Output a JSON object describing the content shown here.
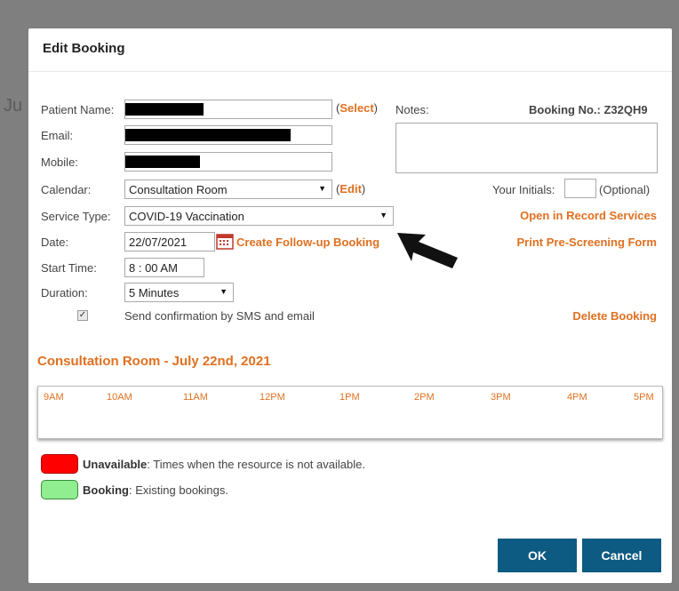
{
  "background": {
    "fragment": "Ju"
  },
  "dialog": {
    "title": "Edit Booking",
    "patient_name": {
      "label": "Patient Name:",
      "select_link": "Select",
      "open_paren": "(",
      "close_paren": ")"
    },
    "email": {
      "label": "Email:"
    },
    "mobile": {
      "label": "Mobile:"
    },
    "notes": {
      "label": "Notes:"
    },
    "booking_no": "Booking No.: Z32QH9",
    "calendar": {
      "label": "Calendar:",
      "value": "Consultation Room",
      "edit_link": "Edit",
      "open_paren": "(",
      "close_paren": ")"
    },
    "initials": {
      "label": "Your Initials:",
      "value": "",
      "optional": "(Optional)"
    },
    "service_type": {
      "label": "Service Type:",
      "value": "COVID-19 Vaccination"
    },
    "open_record_link": "Open in Record Services",
    "date": {
      "label": "Date:",
      "value": "22/07/2021"
    },
    "follow_up_link": "Create Follow-up Booking",
    "print_form_link": "Print Pre-Screening Form",
    "start_time": {
      "label": "Start Time:",
      "value": "8 : 00 AM"
    },
    "duration": {
      "label": "Duration:",
      "value": "5 Minutes"
    },
    "confirmation": {
      "label": "Send confirmation by SMS and email",
      "checked": true
    },
    "delete_link": "Delete Booking",
    "schedule_title": "Consultation Room - July 22nd, 2021",
    "timeline_ticks": [
      "9AM",
      "10AM",
      "11AM",
      "12PM",
      "1PM",
      "2PM",
      "3PM",
      "4PM",
      "5PM"
    ],
    "legend": [
      {
        "label": "Unavailable",
        "desc": ": Times when the resource is not available.",
        "color": "#ff0000"
      },
      {
        "label": "Booking",
        "desc": ": Existing bookings.",
        "color": "#90ee90"
      }
    ],
    "ok_label": "OK",
    "cancel_label": "Cancel"
  },
  "colors": {
    "accent": "#e07020",
    "button": "#0d5a82"
  }
}
